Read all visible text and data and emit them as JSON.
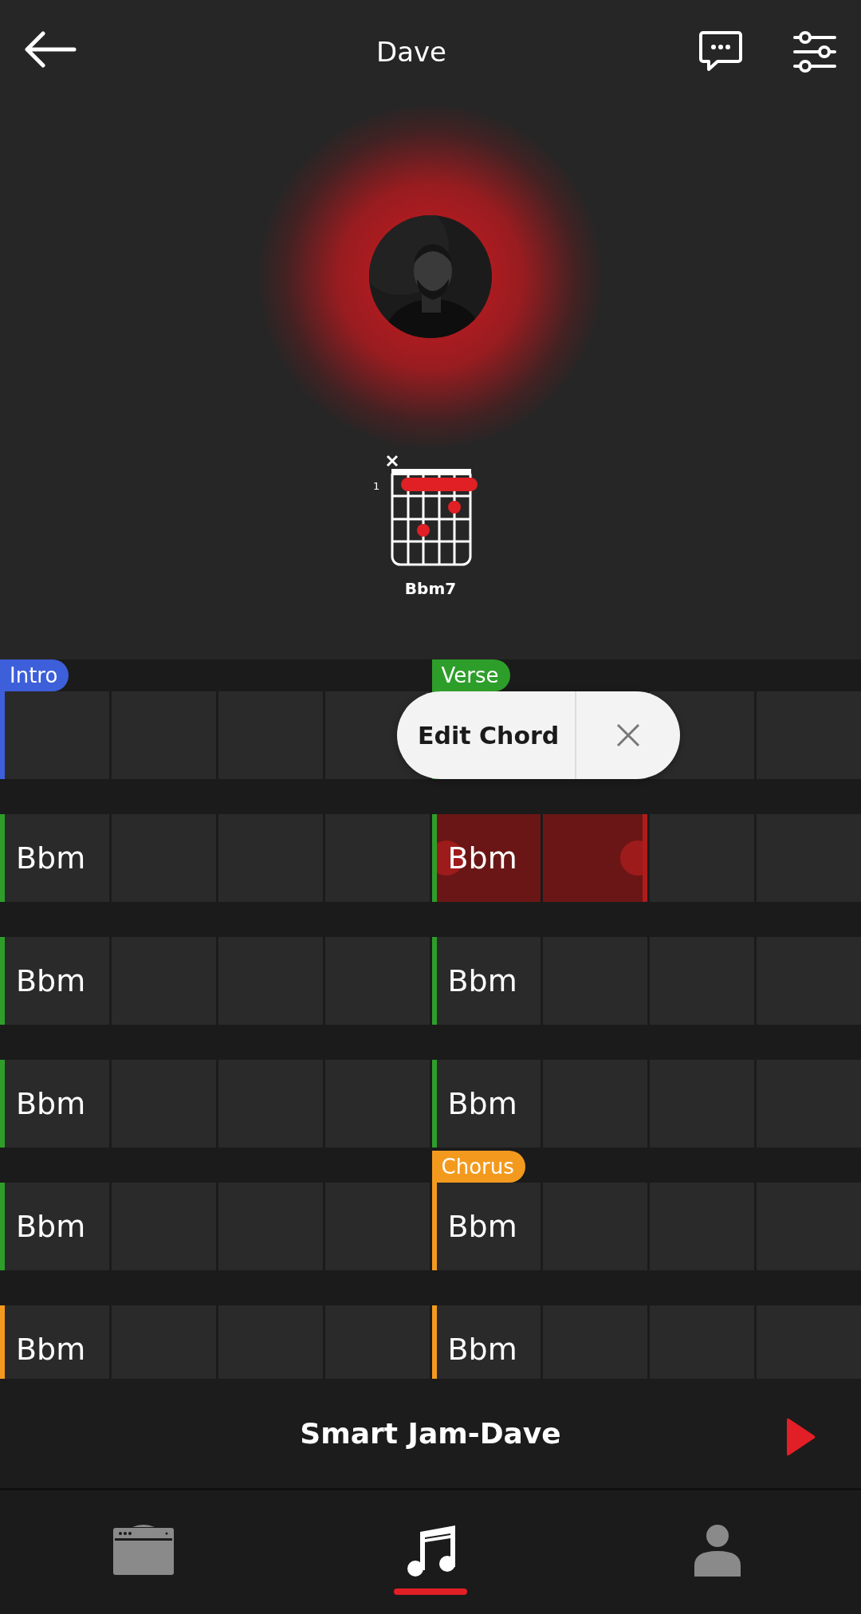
{
  "header": {
    "title": "Dave"
  },
  "chord_diagram": {
    "fret_label": "1",
    "name": "Bbm7"
  },
  "grid": {
    "rows": [
      {
        "measures": [
          {
            "color": "#3d5fd9",
            "tag": "Intro",
            "cells": [
              {
                "selected": false
              },
              {
                "selected": false
              },
              {
                "selected": false
              },
              {
                "selected": false
              }
            ]
          },
          {
            "color": "#2e9e2a",
            "tag": "Verse",
            "cells": [
              {
                "selected": false
              },
              {
                "selected": false
              },
              {
                "selected": false
              }
            ]
          }
        ]
      },
      {
        "measures": [
          {
            "color": "#2e9e2a",
            "cells": [
              {
                "chord": "Bbm",
                "selected": false
              },
              {
                "selected": false
              },
              {
                "selected": false
              },
              {
                "selected": false
              }
            ]
          },
          {
            "color": "#2e9e2a",
            "cells": [
              {
                "chord": "Bbm",
                "selected": true
              },
              {
                "selected": true
              },
              {
                "selected": false
              },
              {
                "selected": false
              }
            ]
          }
        ]
      },
      {
        "measures": [
          {
            "color": "#2e9e2a",
            "cells": [
              {
                "chord": "Bbm",
                "selected": false
              },
              {
                "selected": false
              },
              {
                "selected": false
              },
              {
                "selected": false
              }
            ]
          },
          {
            "color": "#2e9e2a",
            "cells": [
              {
                "chord": "Bbm",
                "selected": false
              },
              {
                "selected": false
              },
              {
                "selected": false
              },
              {
                "selected": false
              }
            ]
          }
        ]
      },
      {
        "measures": [
          {
            "color": "#2e9e2a",
            "cells": [
              {
                "chord": "Bbm",
                "selected": false
              },
              {
                "selected": false
              },
              {
                "selected": false
              },
              {
                "selected": false
              }
            ]
          },
          {
            "color": "#2e9e2a",
            "cells": [
              {
                "chord": "Bbm",
                "selected": false
              },
              {
                "selected": false
              },
              {
                "selected": false
              },
              {
                "selected": false
              }
            ]
          }
        ]
      },
      {
        "measures": [
          {
            "color": "#2e9e2a",
            "cells": [
              {
                "chord": "Bbm",
                "selected": false
              },
              {
                "selected": false
              },
              {
                "selected": false
              },
              {
                "selected": false
              }
            ]
          },
          {
            "color": "#f39a1e",
            "tag": "Chorus",
            "cells": [
              {
                "chord": "Bbm",
                "selected": false
              },
              {
                "selected": false
              },
              {
                "selected": false
              },
              {
                "selected": false
              }
            ]
          }
        ]
      },
      {
        "measures": [
          {
            "color": "#f39a1e",
            "cells": [
              {
                "chord": "Bbm",
                "selected": false
              },
              {
                "selected": false
              },
              {
                "selected": false
              },
              {
                "selected": false
              }
            ]
          },
          {
            "color": "#f39a1e",
            "cells": [
              {
                "chord": "Bbm",
                "selected": false
              },
              {
                "selected": false
              },
              {
                "selected": false
              },
              {
                "selected": false
              }
            ]
          }
        ]
      }
    ]
  },
  "popup": {
    "action": "Edit Chord"
  },
  "player": {
    "title": "Smart Jam-Dave"
  },
  "nav": [
    {
      "kind": "amp",
      "selected": false
    },
    {
      "kind": "music",
      "selected": true
    },
    {
      "kind": "profile",
      "selected": false
    }
  ]
}
